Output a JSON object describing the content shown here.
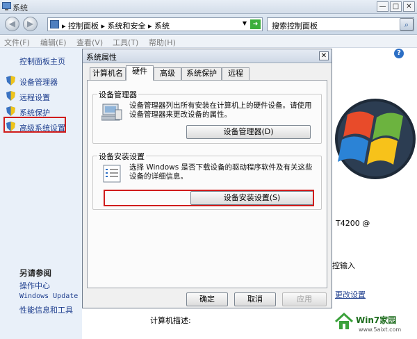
{
  "window": {
    "title": "系统",
    "minimize": "—",
    "maximize": "□",
    "close": "✕"
  },
  "address": {
    "breadcrumb": "▸ 控制面板 ▸ 系统和安全 ▸ 系统",
    "search_placeholder": "搜索控制面板"
  },
  "menu": [
    "文件(F)",
    "编辑(E)",
    "查看(V)",
    "工具(T)",
    "帮助(H)"
  ],
  "sidebar": {
    "home": "控制面板主页",
    "items": [
      {
        "label": "设备管理器"
      },
      {
        "label": "远程设置"
      },
      {
        "label": "系统保护"
      },
      {
        "label": "高级系统设置"
      }
    ],
    "see_also_title": "另请参阅",
    "see_also": [
      "操作中心",
      "Windows Update",
      "性能信息和工具"
    ]
  },
  "dialog": {
    "title": "系统属性",
    "tabs": [
      "计算机名",
      "硬件",
      "高级",
      "系统保护",
      "远程"
    ],
    "active_tab": "硬件",
    "device_manager": {
      "group_label": "设备管理器",
      "description": "设备管理器列出所有安装在计算机上的硬件设备。请使用设备管理器来更改设备的属性。",
      "button": "设备管理器(D)"
    },
    "device_install": {
      "group_label": "设备安装设置",
      "description": "选择 Windows 是否下载设备的驱动程序软件及有关这些设备的详细信息。",
      "button": "设备安装设置(S)"
    },
    "ok": "确定",
    "cancel": "取消",
    "apply": "应用"
  },
  "background": {
    "cpu_suffix": "T4200  @",
    "pen_input": "控输入",
    "change_settings": "更改设置",
    "computer_desc": "计算机描述:"
  },
  "watermark": {
    "brand": "Win7家园",
    "url": "www.5aixt.com"
  },
  "colors": {
    "highlight": "#d01c1c",
    "link": "#1e3e8e"
  }
}
